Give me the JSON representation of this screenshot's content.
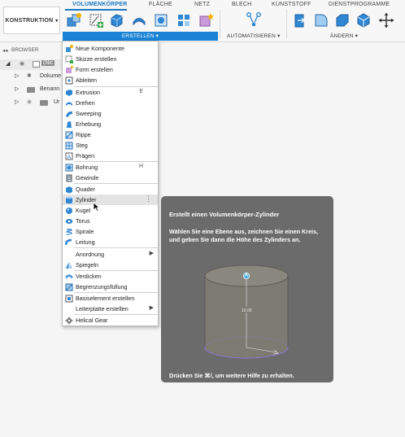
{
  "workspace": {
    "label": "KONSTRUKTION"
  },
  "tabs": [
    {
      "label": "VOLUMENKÖRPER",
      "active": true
    },
    {
      "label": "FLÄCHE"
    },
    {
      "label": "NETZ"
    },
    {
      "label": "BLECH"
    },
    {
      "label": "KUNSTSTOFF"
    },
    {
      "label": "DIENSTPROGRAMME"
    }
  ],
  "groups": {
    "erstellen": "ERSTELLEN ▾",
    "automatisieren": "AUTOMATISIEREN ▾",
    "aendern": "ÄNDERN ▾"
  },
  "browser": {
    "header": "BROWSER",
    "rows": [
      {
        "label": "(Nic"
      },
      {
        "label": "Dokume"
      },
      {
        "label": "Benann"
      },
      {
        "label": "Ur"
      }
    ]
  },
  "menu": {
    "items": [
      {
        "label": "Neue Komponente"
      },
      {
        "label": "Skizze erstellen"
      },
      {
        "label": "Form erstellen"
      },
      {
        "label": "Ableiten"
      },
      {
        "label": "Extrusion",
        "shortcut": "E"
      },
      {
        "label": "Drehen"
      },
      {
        "label": "Sweeping"
      },
      {
        "label": "Erhebung"
      },
      {
        "label": "Rippe"
      },
      {
        "label": "Steg"
      },
      {
        "label": "Prägen"
      },
      {
        "label": "Bohrung",
        "shortcut": "H"
      },
      {
        "label": "Gewinde"
      },
      {
        "label": "Quader"
      },
      {
        "label": "Zylinder",
        "more": "⋮"
      },
      {
        "label": "Kugel"
      },
      {
        "label": "Torus"
      },
      {
        "label": "Spirale"
      },
      {
        "label": "Leitung"
      },
      {
        "label": "Anordnung",
        "arrow": "▶"
      },
      {
        "label": "Spiegeln"
      },
      {
        "label": "Verdicken"
      },
      {
        "label": "Begrenzungsfüllung"
      },
      {
        "label": "Basiselement erstellen"
      },
      {
        "label": "Leiterplatte erstellen",
        "arrow": "▶"
      },
      {
        "label": "Helical Gear"
      }
    ],
    "highlighted": "Zylinder"
  },
  "tooltip": {
    "title": "Erstellt einen Volumenkörper-Zylinder",
    "description": "Wählen Sie eine Ebene aus, zeichnen Sie einen Kreis, und geben Sie dann die Höhe des Zylinders an.",
    "footer": "Drücken Sie ⌘/, um weitere Hilfe zu erhalten.",
    "dimension": "10.00"
  },
  "colors": {
    "accent": "#1a83d4",
    "tooltip_bg": "#6b6b6b",
    "highlight": "#e4e4e4"
  }
}
